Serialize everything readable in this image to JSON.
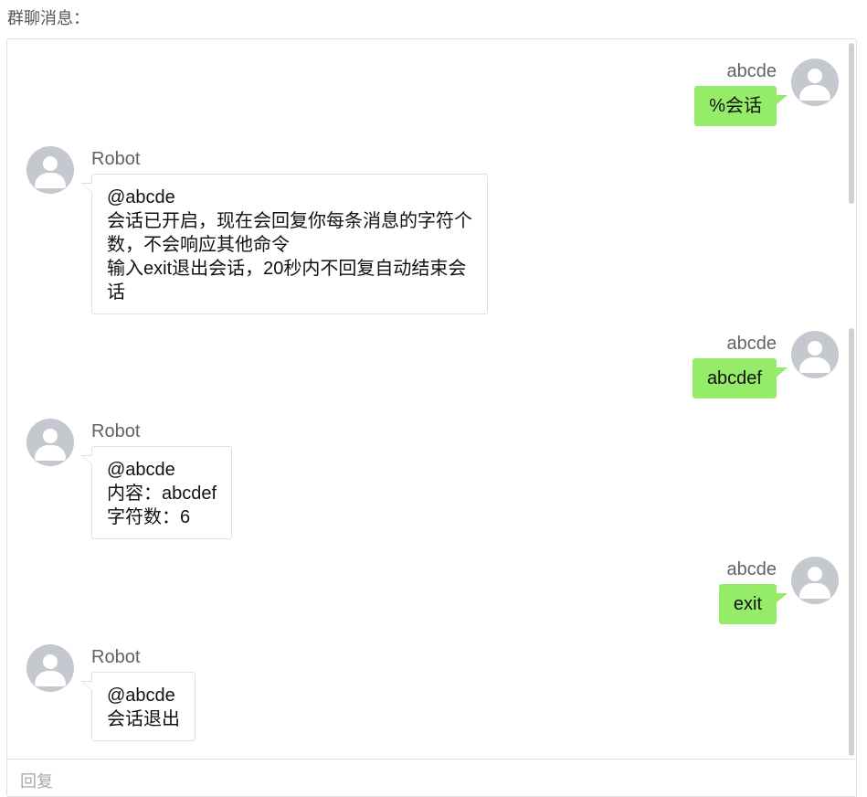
{
  "page_title": "群聊消息：",
  "reply": {
    "placeholder": "回复"
  },
  "messages": [
    {
      "side": "right",
      "sender": "abcde",
      "lines": [
        "%会话"
      ]
    },
    {
      "side": "left",
      "sender": "Robot",
      "lines": [
        "@abcde",
        "会话已开启，现在会回复你每条消息的字符个",
        "数，不会响应其他命令",
        "输入exit退出会话，20秒内不回复自动结束会",
        "话"
      ]
    },
    {
      "side": "right",
      "sender": "abcde",
      "lines": [
        "abcdef"
      ]
    },
    {
      "side": "left",
      "sender": "Robot",
      "lines": [
        "@abcde",
        "内容：abcdef",
        "字符数：6"
      ]
    },
    {
      "side": "right",
      "sender": "abcde",
      "lines": [
        "exit"
      ]
    },
    {
      "side": "left",
      "sender": "Robot",
      "lines": [
        "@abcde",
        "会话退出"
      ]
    }
  ],
  "colors": {
    "outgoing_bubble": "#95ec69",
    "incoming_bubble": "#ffffff",
    "avatar": "#c5c8ce"
  },
  "icons": {
    "avatar": "user-avatar-icon"
  }
}
